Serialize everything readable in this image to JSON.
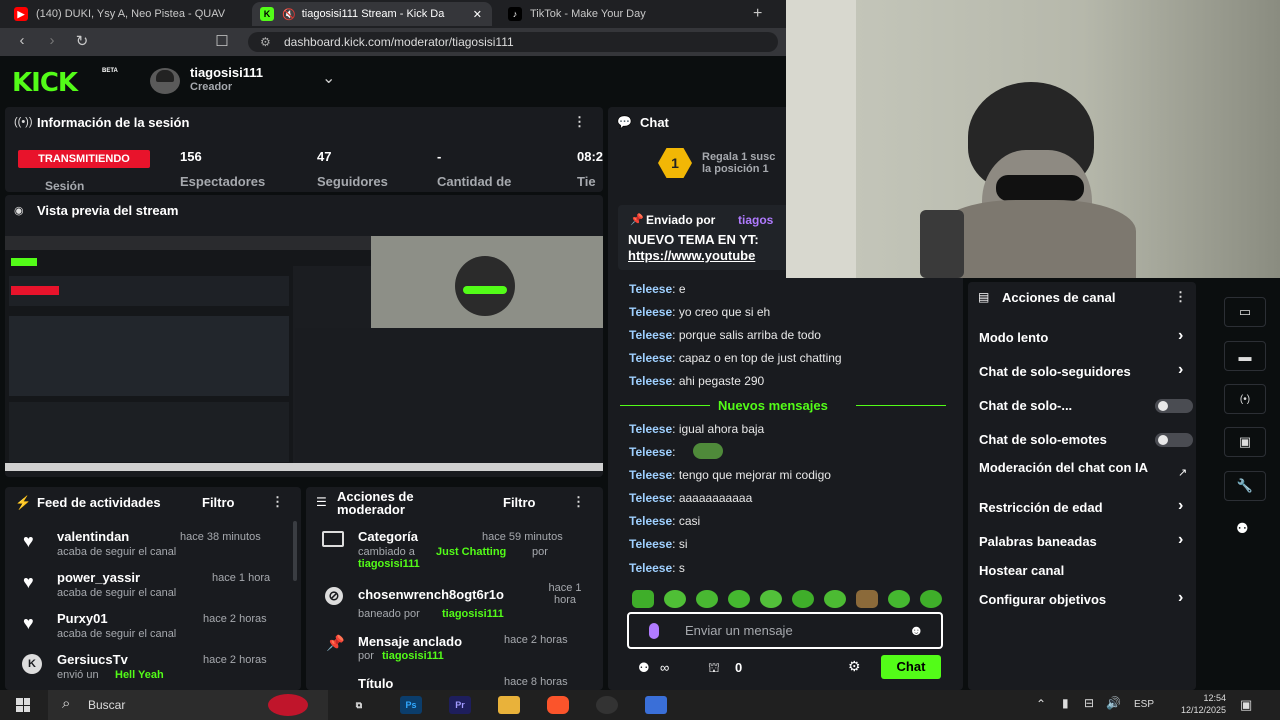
{
  "browser": {
    "tabs": [
      {
        "title": "(140) DUKI, Ysy A, Neo Pistea - QUAV",
        "active": false
      },
      {
        "title": "tiagosisi111 Stream - Kick Da",
        "active": true
      },
      {
        "title": "TikTok - Make Your Day",
        "active": false
      }
    ],
    "url": "dashboard.kick.com/moderator/tiagosisi111"
  },
  "kick": {
    "logo": "KICK",
    "beta": "BETA",
    "user_name": "tiagosisi111",
    "user_role": "Creador"
  },
  "session": {
    "title": "Información de la sesión",
    "live_badge": "TRANSMITIENDO",
    "session_label": "Sesión",
    "stats": [
      {
        "value": "156",
        "label": "Espectadores"
      },
      {
        "value": "47",
        "label": "Seguidores"
      },
      {
        "value": "-",
        "label": "Cantidad de"
      },
      {
        "value": "08:2",
        "label": "Tie"
      }
    ]
  },
  "preview": {
    "title": "Vista previa del stream"
  },
  "activity": {
    "title": "Feed de actividades",
    "filter": "Filtro",
    "items": [
      {
        "user": "valentindan",
        "time": "hace 38 minutos",
        "desc": "acaba de seguir el canal",
        "extra": ""
      },
      {
        "user": "power_yassir",
        "time": "hace 1 hora",
        "desc": "acaba de seguir el canal",
        "extra": ""
      },
      {
        "user": "Purxy01",
        "time": "hace 2 horas",
        "desc": "acaba de seguir el canal",
        "extra": ""
      },
      {
        "user": "GersiucsTv",
        "time": "hace 2 horas",
        "desc": "envió un",
        "extra": "Hell Yeah"
      }
    ]
  },
  "modactions": {
    "title_line1": "Acciones de",
    "title_line2": "moderador",
    "filter": "Filtro",
    "items": [
      {
        "title": "Categoría",
        "time": "hace 59 minutos",
        "line": "cambiado a",
        "target": "Just Chatting",
        "by": "por",
        "user": "tiagosisi111"
      },
      {
        "title": "chosenwrench8ogt6r1o",
        "time": "hace 1 hora",
        "line": "baneado por",
        "target": "",
        "by": "",
        "user": "tiagosisi111"
      },
      {
        "title": "Mensaje anclado",
        "time": "hace 2 horas",
        "line": "por",
        "target": "",
        "by": "",
        "user": "tiagosisi111"
      },
      {
        "title": "Título",
        "time": "hace 8 horas"
      }
    ]
  },
  "chat": {
    "title": "Chat",
    "gift_line1": "Regala 1 susc",
    "gift_line2": "la posición 1",
    "gift_num": "1",
    "pinned_label": "Enviado por",
    "pinned_user": "tiagos",
    "pinned_text": "NUEVO TEMA EN YT:",
    "pinned_link": "https://www.youtube",
    "messages": [
      {
        "user": "Teleese",
        "text": "e"
      },
      {
        "user": "Teleese",
        "text": "yo creo que si eh"
      },
      {
        "user": "Teleese",
        "text": "porque salis arriba de todo"
      },
      {
        "user": "Teleese",
        "text": "capaz o en top de just chatting"
      },
      {
        "user": "Teleese",
        "text": "ahi pegaste 290"
      }
    ],
    "new_messages": "Nuevos mensajes",
    "messages2": [
      {
        "user": "Teleese",
        "text": "igual ahora baja"
      },
      {
        "user": "Teleese",
        "text": ""
      },
      {
        "user": "Teleese",
        "text": "tengo que mejorar mi codigo"
      },
      {
        "user": "Teleese",
        "text": "aaaaaaaaaaa"
      },
      {
        "user": "Teleese",
        "text": "casi"
      },
      {
        "user": "Teleese",
        "text": "si"
      },
      {
        "user": "Teleese",
        "text": "s"
      }
    ],
    "placeholder": "Enviar un mensaje",
    "points": "0",
    "send": "Chat"
  },
  "channel": {
    "title": "Acciones de canal",
    "items": [
      {
        "label": "Modo lento",
        "kind": "arrow"
      },
      {
        "label": "Chat de solo-seguidores",
        "kind": "arrow"
      },
      {
        "label": "Chat de solo-...",
        "kind": "toggle"
      },
      {
        "label": "Chat de solo-emotes",
        "kind": "toggle"
      },
      {
        "label": "Moderación del chat con IA",
        "kind": "ext"
      },
      {
        "label": "Restricción de edad",
        "kind": "arrow"
      },
      {
        "label": "Palabras baneadas",
        "kind": "arrow"
      },
      {
        "label": "Hostear canal",
        "kind": "none"
      },
      {
        "label": "Configurar objetivos",
        "kind": "arrow"
      }
    ]
  },
  "taskbar": {
    "search": "Buscar",
    "lang": "ESP",
    "time": "12:54",
    "date": "12/12/2025",
    "apps": [
      "Ps",
      "Pr"
    ]
  },
  "colors": {
    "kick_green": "#53fc18",
    "live_red": "#e8132b",
    "panel": "#191b1f",
    "bg": "#0b0e0f"
  }
}
